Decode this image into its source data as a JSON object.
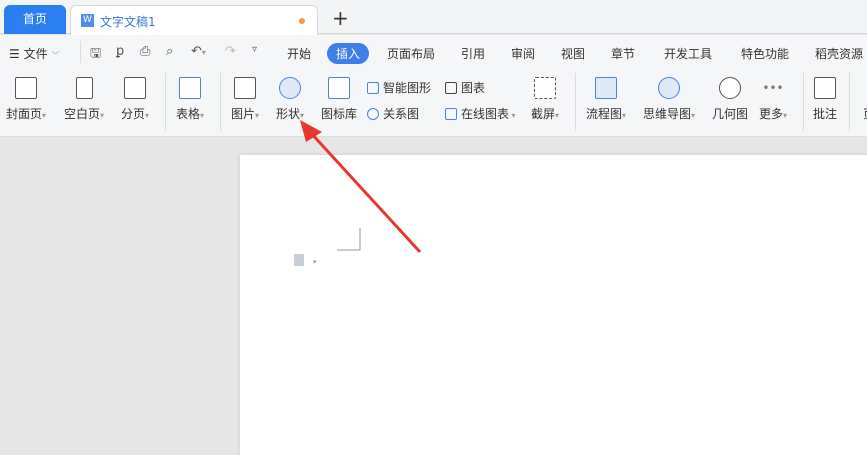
{
  "tabs": {
    "home": "首页",
    "doc": "文字文稿1",
    "doc_icon": "W",
    "new_tab": "+"
  },
  "menu": {
    "file": "文件",
    "items": [
      "开始",
      "插入",
      "页面布局",
      "引用",
      "审阅",
      "视图",
      "章节",
      "开发工具",
      "特色功能",
      "稻壳资源"
    ],
    "active": "插入"
  },
  "ribbon": {
    "large": [
      {
        "label": "封面页",
        "icon": "cover-page-icon"
      },
      {
        "label": "空白页",
        "icon": "blank-page-icon"
      },
      {
        "label": "分页",
        "icon": "page-break-icon"
      },
      {
        "label": "表格",
        "icon": "table-icon"
      },
      {
        "label": "图片",
        "icon": "picture-icon"
      },
      {
        "label": "形状",
        "icon": "shape-icon"
      },
      {
        "label": "图标库",
        "icon": "icon-library-icon"
      }
    ],
    "small": [
      {
        "label": "智能图形",
        "icon": "smart-art-icon"
      },
      {
        "label": "关系图",
        "icon": "relation-chart-icon"
      },
      {
        "label": "图表",
        "icon": "chart-icon"
      },
      {
        "label": "在线图表",
        "icon": "online-chart-icon"
      }
    ],
    "large2": [
      {
        "label": "截屏",
        "icon": "screenshot-icon"
      },
      {
        "label": "流程图",
        "icon": "flowchart-icon"
      },
      {
        "label": "思维导图",
        "icon": "mindmap-icon"
      },
      {
        "label": "几何图",
        "icon": "geometry-icon"
      },
      {
        "label": "更多",
        "icon": "more-icon"
      },
      {
        "label": "批注",
        "icon": "comment-icon"
      },
      {
        "label": "页",
        "icon": "page-icon"
      }
    ]
  },
  "colors": {
    "accent": "#2a7ef0",
    "arrow": "#e8382e"
  }
}
